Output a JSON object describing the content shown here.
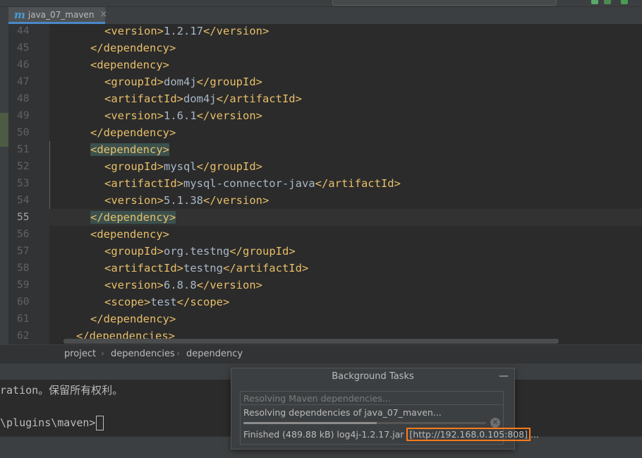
{
  "tab": {
    "icon": "m",
    "title": "java_07_maven",
    "close": "×"
  },
  "editor": {
    "lines": [
      {
        "n": "44",
        "indent": "      ",
        "parts": [
          [
            "tag",
            "<version>"
          ],
          [
            "txt",
            "1.2.17"
          ],
          [
            "tag",
            "</version>"
          ]
        ]
      },
      {
        "n": "45",
        "indent": "    ",
        "parts": [
          [
            "tag",
            "</dependency>"
          ]
        ]
      },
      {
        "n": "46",
        "indent": "    ",
        "parts": [
          [
            "tag",
            "<dependency>"
          ]
        ]
      },
      {
        "n": "47",
        "indent": "      ",
        "parts": [
          [
            "tag",
            "<groupId>"
          ],
          [
            "txt",
            "dom4j"
          ],
          [
            "tag",
            "</groupId>"
          ]
        ]
      },
      {
        "n": "48",
        "indent": "      ",
        "parts": [
          [
            "tag",
            "<artifactId>"
          ],
          [
            "txt",
            "dom4j"
          ],
          [
            "tag",
            "</artifactId>"
          ]
        ]
      },
      {
        "n": "49",
        "indent": "      ",
        "parts": [
          [
            "tag",
            "<version>"
          ],
          [
            "txt",
            "1.6.1"
          ],
          [
            "tag",
            "</version>"
          ]
        ]
      },
      {
        "n": "50",
        "indent": "    ",
        "parts": [
          [
            "tag",
            "</dependency>"
          ]
        ]
      },
      {
        "n": "51",
        "indent": "    ",
        "parts": [
          [
            "taghl",
            "<dependency>"
          ]
        ]
      },
      {
        "n": "52",
        "indent": "      ",
        "parts": [
          [
            "tag",
            "<groupId>"
          ],
          [
            "txt",
            "mysql"
          ],
          [
            "tag",
            "</groupId>"
          ]
        ]
      },
      {
        "n": "53",
        "indent": "      ",
        "parts": [
          [
            "tag",
            "<artifactId>"
          ],
          [
            "txt",
            "mysql-connector-java"
          ],
          [
            "tag",
            "</artifactId>"
          ]
        ]
      },
      {
        "n": "54",
        "indent": "      ",
        "parts": [
          [
            "tag",
            "<version>"
          ],
          [
            "txt",
            "5.1.38"
          ],
          [
            "tag",
            "</version>"
          ]
        ]
      },
      {
        "n": "55",
        "indent": "    ",
        "parts": [
          [
            "taghl",
            "</dependency>"
          ]
        ],
        "current": true
      },
      {
        "n": "56",
        "indent": "    ",
        "parts": [
          [
            "tag",
            "<dependency>"
          ]
        ]
      },
      {
        "n": "57",
        "indent": "      ",
        "parts": [
          [
            "tag",
            "<groupId>"
          ],
          [
            "txt",
            "org.testng"
          ],
          [
            "tag",
            "</groupId>"
          ]
        ]
      },
      {
        "n": "58",
        "indent": "      ",
        "parts": [
          [
            "tag",
            "<artifactId>"
          ],
          [
            "txt",
            "testng"
          ],
          [
            "tag",
            "</artifactId>"
          ]
        ]
      },
      {
        "n": "59",
        "indent": "      ",
        "parts": [
          [
            "tag",
            "<version>"
          ],
          [
            "txt",
            "6.8.8"
          ],
          [
            "tag",
            "</version>"
          ]
        ]
      },
      {
        "n": "60",
        "indent": "      ",
        "parts": [
          [
            "tag",
            "<scope>"
          ],
          [
            "txt",
            "test"
          ],
          [
            "tag",
            "</scope>"
          ]
        ]
      },
      {
        "n": "61",
        "indent": "    ",
        "parts": [
          [
            "tag",
            "</dependency>"
          ]
        ]
      },
      {
        "n": "62",
        "indent": "  ",
        "parts": [
          [
            "tag",
            "</dependencies>"
          ]
        ]
      }
    ]
  },
  "breadcrumb": {
    "items": [
      "project",
      "dependencies",
      "dependency"
    ],
    "sep": "›"
  },
  "terminal": {
    "line1": "ration。保留所有权利。",
    "line2": "\\plugins\\maven>"
  },
  "background_tasks": {
    "title": "Background Tasks",
    "minimize": "—",
    "task1": "Resolving Maven dependencies...",
    "task2_line1": "Resolving dependencies of java_07_maven...",
    "task2_progress": 0.55,
    "task2_line3_prefix": "Finished (489.88 kB) log4j-1.2.17.jar ",
    "task2_line3_url": "[http://192.168.0.105:808]",
    "task2_line3_suffix": "..."
  },
  "colors": {
    "tag": "#e8bf6a",
    "text": "#a9b7c6",
    "highlight": "#3b514d",
    "url_box": "#ff7a1a"
  }
}
